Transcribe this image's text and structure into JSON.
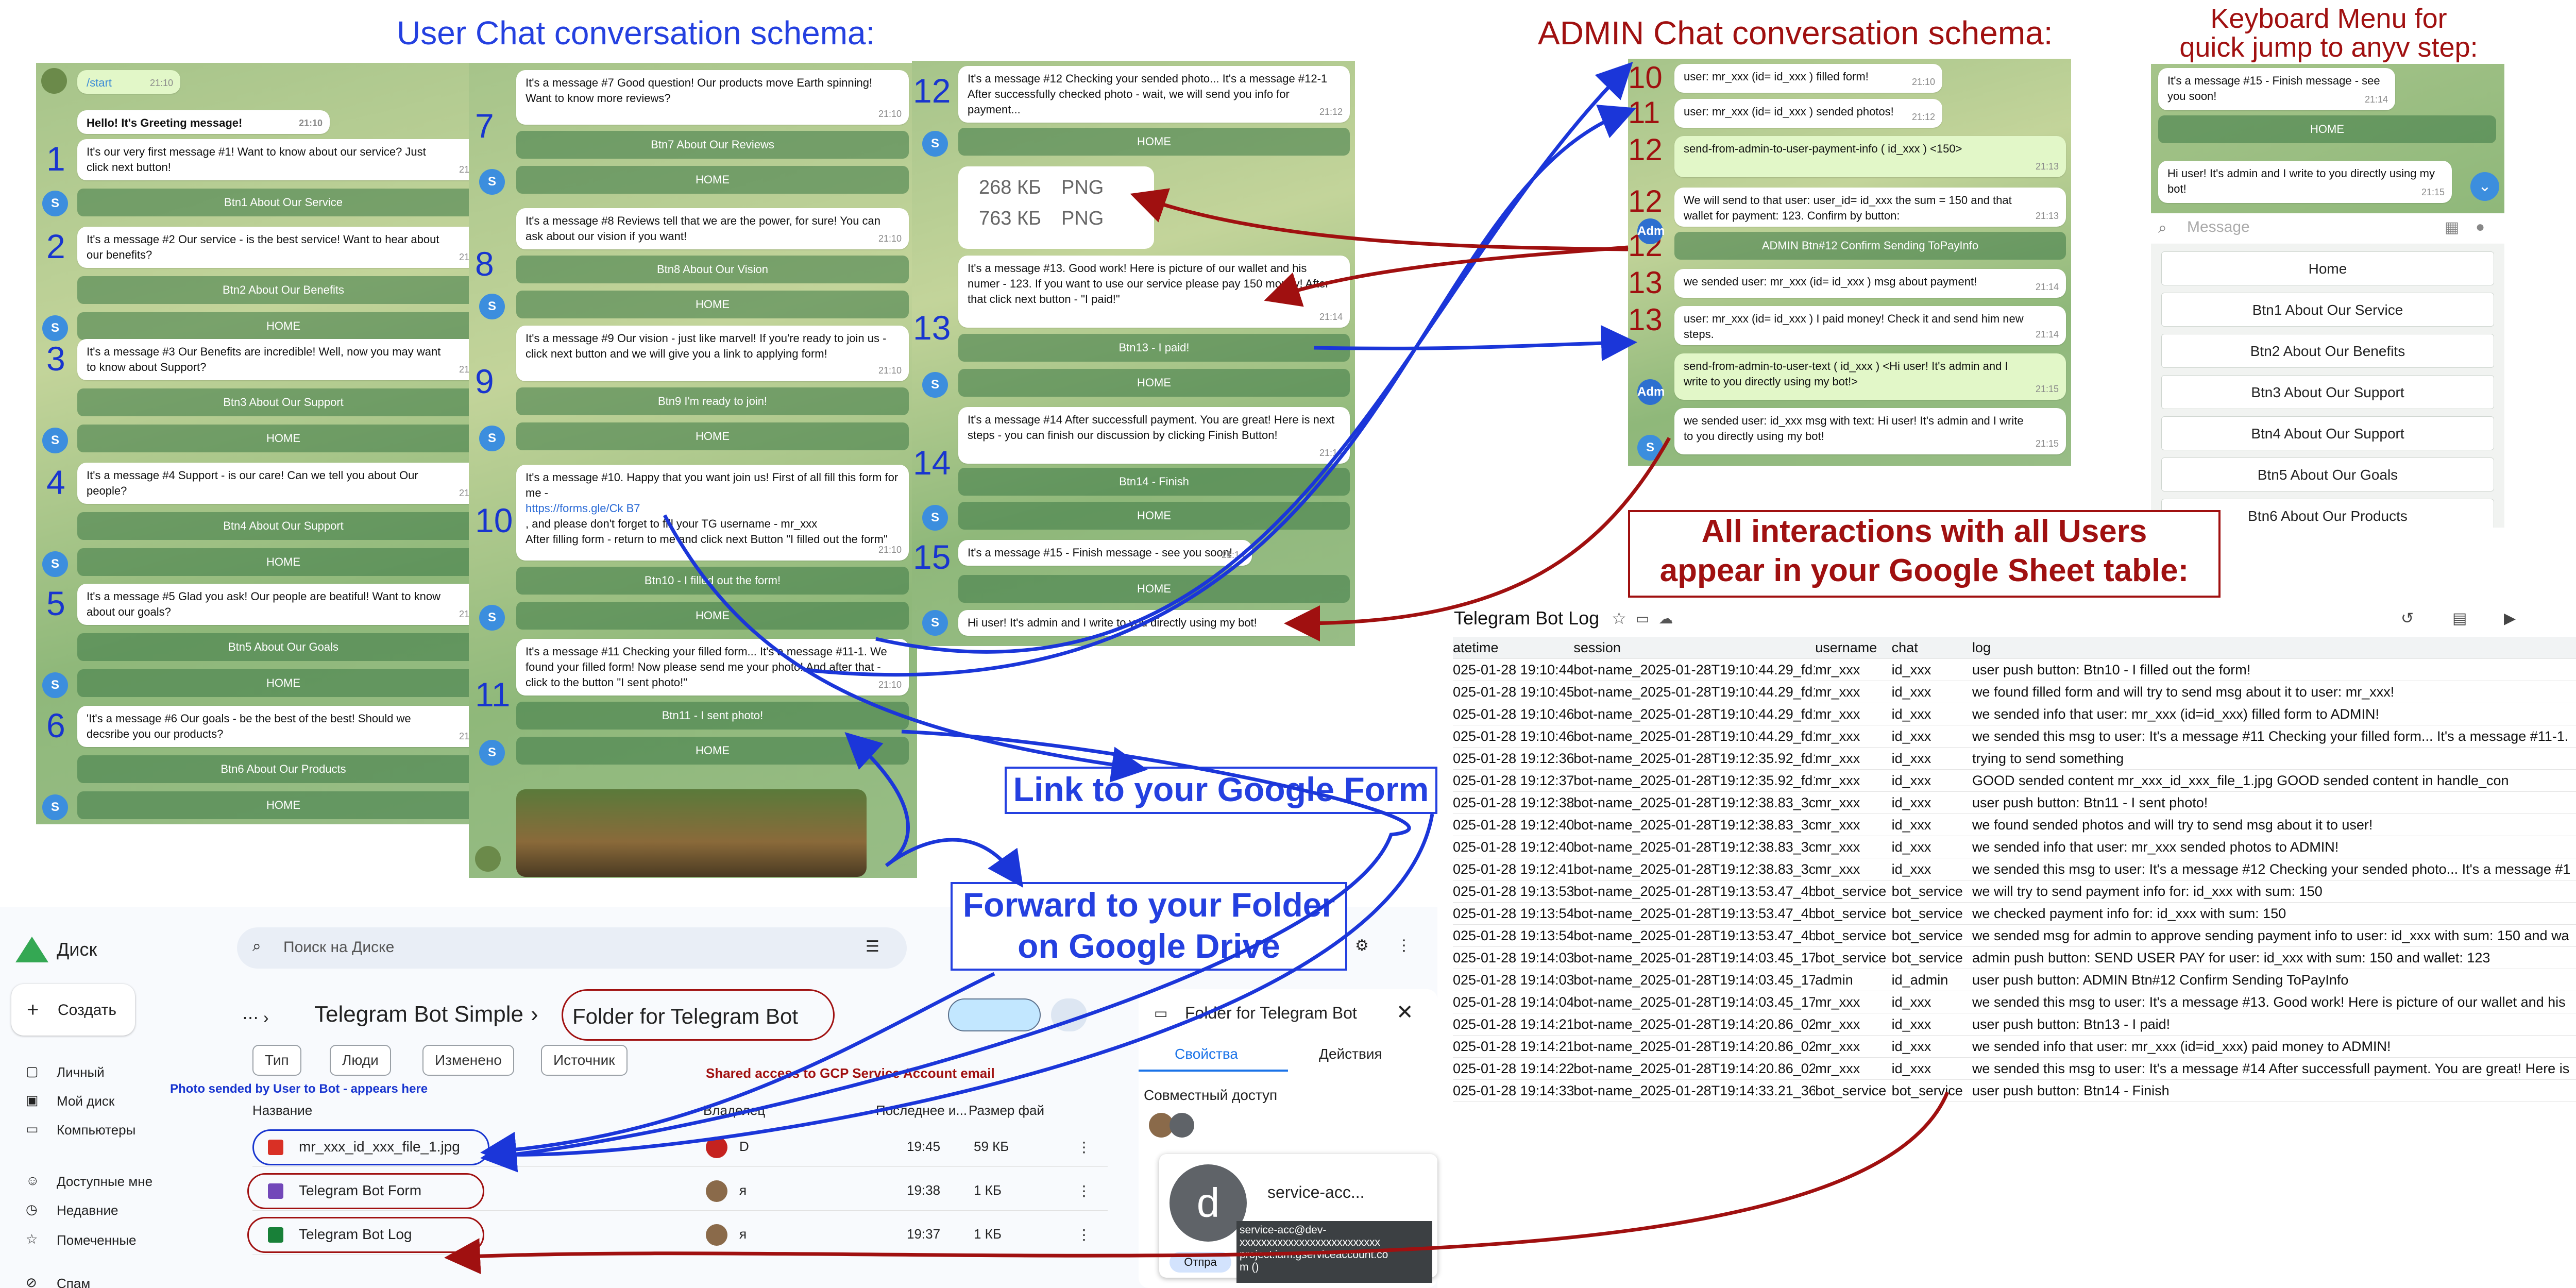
{
  "titles": {
    "user": "User Chat conversation schema:",
    "admin": "ADMIN Chat conversation schema:",
    "keyboard": "Keyboard Menu for\nquick jump to anyv step:",
    "interactions": "All interactions with all Users\nappear in your Google Sheet table:",
    "link_form": "Link to your Google Form",
    "forward_folder": "Forward to your Folder\non Google Drive"
  },
  "colors": {
    "accent_blue": "#2440e0",
    "accent_red": "#a01010",
    "chat_bg": "#a6c48a"
  },
  "col1": {
    "start": {
      "text": "/start",
      "time": "21:10"
    },
    "hello": {
      "text": "Hello! It's Greeting message!",
      "time": "21:10"
    },
    "items": [
      {
        "num": "1",
        "text": "It's our very first message #1! Want to know about our service? Just click next button!",
        "time": "21:10",
        "btn": "Btn1 About Our Service",
        "home": ""
      },
      {
        "num": "2",
        "text": "It's a message #2 Our service - is the best service! Want to hear about our benefits?",
        "time": "21:10",
        "btn": "Btn2 About Our Benefits",
        "home": "HOME"
      },
      {
        "num": "3",
        "text": "It's a message #3 Our Benefits are incredible! Well, now you may want to know about Support?",
        "time": "21:10",
        "btn": "Btn3 About Our Support",
        "home": "HOME"
      },
      {
        "num": "4",
        "text": "It's a message #4 Support - is our care! Can we tell you about Our people?",
        "time": "21:10",
        "btn": "Btn4 About Our Support",
        "home": "HOME"
      },
      {
        "num": "5",
        "text": "It's a message #5 Glad you ask! Our people are beatiful! Want to know about our goals?",
        "time": "21:10",
        "btn": "Btn5 About Our Goals",
        "home": "HOME"
      },
      {
        "num": "6",
        "text": "'It's a message #6 Our goals - be the best of the best! Should we decsribe you our products?",
        "time": "21:10",
        "btn": "Btn6 About Our Products",
        "home": "HOME"
      }
    ]
  },
  "col2": {
    "items": [
      {
        "num": "7",
        "text": "It's a message #7 Good question! Our products move Earth spinning! Want to know more reviews?",
        "time": "21:10",
        "btn": "Btn7 About Our Reviews",
        "home": "HOME"
      },
      {
        "num": "8",
        "text": "It's a message #8 Reviews tell that we are the power, for sure! You can ask about our vision if you want!",
        "time": "21:10",
        "btn": "Btn8 About Our Vision",
        "home": "HOME"
      },
      {
        "num": "9",
        "text": "It's a message #9 Our vision - just like marvel! If you're ready to join us - click next button and we will give you a link to applying form!",
        "time": "21:10",
        "btn": "Btn9 I'm ready to join!",
        "home": "HOME"
      },
      {
        "num": "10",
        "text": "It's a message #10. Happy that you want join us! First of all fill this form for me -",
        "link": "https://forms.gle/Ck                B7",
        "text2": ", and please don't forget to fill your TG username - mr_xxx",
        "text3": "After filling form - return to me and click next Button \"I filled out the form\"",
        "time": "21:10",
        "btn": "Btn10 - I filled out the form!",
        "home": "HOME"
      },
      {
        "num": "11",
        "text": "It's a message #11 Checking your filled form... It's a message #11-1. We found your filled form! Now please send me your photo! And after that - click to the button \"I sent photo!\"",
        "time": "21:10",
        "btn": "Btn11 - I sent photo!",
        "home": "HOME"
      }
    ]
  },
  "col3": {
    "m12": {
      "num": "12",
      "text": "It's a message #12 Checking your sended photo... It's a message #12-1 After successfully checked photo - wait, we will send you info for payment...",
      "time": "21:12",
      "home": "HOME"
    },
    "files": [
      {
        "size": "268 КБ",
        "type": "PNG"
      },
      {
        "size": "763 КБ",
        "type": "PNG"
      }
    ],
    "m13": {
      "num": "13",
      "text": "It's a message #13. Good work! Here is picture of our wallet and his numer - 123. If you want to use our service please pay 150 money! After that click next button - \"I paid!\"",
      "time": "21:14",
      "btn": "Btn13 - I paid!",
      "home": "HOME"
    },
    "m14": {
      "num": "14",
      "text": "It's a message #14 After successfull payment. You are great! Here is next steps - you can finish our discussion by clicking Finish Button!",
      "time": "21:14",
      "btn": "Btn14 - Finish",
      "home": "HOME"
    },
    "m15": {
      "num": "15",
      "text": "It's a message #15 - Finish message - see you soon!",
      "time": "21:14",
      "home": "HOME"
    },
    "admin_msg": "Hi user! It's admin and I write to you directly using my bot!"
  },
  "admin": {
    "rows": [
      {
        "num": "10",
        "text": "user:  mr_xxx (id= id_xxx ) filled form!",
        "time": "21:10"
      },
      {
        "num": "11",
        "text": "user:  mr_xxx (id= id_xxx ) sended photos!",
        "time": "21:12"
      },
      {
        "num": "12",
        "text": "send-from-admin-to-user-payment-info ( id_xxx ) <150>",
        "time": "21:13"
      },
      {
        "num": "12",
        "text": "We will send to that user: user_id= id_xxx  the sum = 150 and that wallet for payment: 123. Confirm by button:",
        "time": "21:13"
      },
      {
        "num": "12",
        "text": "ADMIN Btn#12 Confirm Sending ToPayInfo",
        "time": ""
      },
      {
        "num": "13",
        "text": "we sended user: mr_xxx (id= id_xxx ) msg about payment!",
        "time": "21:14"
      },
      {
        "num": "13",
        "text": "user:  mr_xxx (id= id_xxx ) I paid money! Check it and send him new steps.",
        "time": "21:14"
      },
      {
        "num": "",
        "text": "send-from-admin-to-user-text ( id_xxx ) <Hi user! It's admin and I write to you directly using my bot!>",
        "time": "21:15"
      },
      {
        "num": "",
        "text": "we sended user:  id_xxx    msg with text: Hi user! It's admin and I write to you directly using my bot!",
        "time": "21:15"
      }
    ]
  },
  "keyboard": {
    "top_msg": "It's a message #15 - Finish message - see you soon!",
    "top_time": "21:14",
    "home": "HOME",
    "admin_msg": "Hi user! It's admin and I write to you directly using my bot!",
    "admin_time": "21:15",
    "placeholder": "Message",
    "items": [
      "Home",
      "Btn1 About Our Service",
      "Btn2 About Our Benefits",
      "Btn3 About Our Support",
      "Btn4 About Our Support",
      "Btn5 About Our Goals",
      "Btn6 About Our Products"
    ]
  },
  "sheet": {
    "title": "Telegram Bot Log",
    "headers": [
      "atetime",
      "session",
      "username",
      "chat",
      "log"
    ],
    "rows": [
      [
        "025-01-28 19:10:44",
        "bot-name_2025-01-28T19:10:44.29_fd1",
        "mr_xxx",
        "id_xxx",
        "user push button: Btn10 - I filled out the form!"
      ],
      [
        "025-01-28 19:10:45",
        "bot-name_2025-01-28T19:10:44.29_fd1",
        "mr_xxx",
        "id_xxx",
        "we found filled form and will try to send msg about it to user: mr_xxx!"
      ],
      [
        "025-01-28 19:10:46",
        "bot-name_2025-01-28T19:10:44.29_fd1",
        "mr_xxx",
        "id_xxx",
        "we sended info that user: mr_xxx (id=id_xxx) filled form to ADMIN!"
      ],
      [
        "025-01-28 19:10:46",
        "bot-name_2025-01-28T19:10:44.29_fd1",
        "mr_xxx",
        "id_xxx",
        "we sended this msg to user: It's a message #11 Checking your filled form... It's a message #11-1."
      ],
      [
        "025-01-28 19:12:36",
        "bot-name_2025-01-28T19:12:35.92_fd1",
        "mr_xxx",
        "id_xxx",
        "trying to send something"
      ],
      [
        "025-01-28 19:12:37",
        "bot-name_2025-01-28T19:12:35.92_fd1",
        "mr_xxx",
        "id_xxx",
        "GOOD sended content  mr_xxx_id_xxx_file_1.jpg           GOOD sended content in handle_con"
      ],
      [
        "025-01-28 19:12:38",
        "bot-name_2025-01-28T19:12:38.83_3c",
        "mr_xxx",
        "id_xxx",
        "user push button: Btn11 - I sent photo!"
      ],
      [
        "025-01-28 19:12:40",
        "bot-name_2025-01-28T19:12:38.83_3c",
        "mr_xxx",
        "id_xxx",
        "we found sended photos and will try to send msg about it to user!"
      ],
      [
        "025-01-28 19:12:40",
        "bot-name_2025-01-28T19:12:38.83_3c",
        "mr_xxx",
        "id_xxx",
        "we sended info that user: mr_xxx sended photos to ADMIN!"
      ],
      [
        "025-01-28 19:12:41",
        "bot-name_2025-01-28T19:12:38.83_3c",
        "mr_xxx",
        "id_xxx",
        "we sended this msg to user: It's a message #12 Checking your sended photo... It's a message #1"
      ],
      [
        "025-01-28 19:13:53",
        "bot-name_2025-01-28T19:13:53.47_4b",
        "bot_service",
        "bot_service",
        "we will try to send payment info for: id_xxx with sum: 150"
      ],
      [
        "025-01-28 19:13:54",
        "bot-name_2025-01-28T19:13:53.47_4b",
        "bot_service",
        "bot_service",
        "we checked payment info for: id_xxx with sum: 150"
      ],
      [
        "025-01-28 19:13:54",
        "bot-name_2025-01-28T19:13:53.47_4b",
        "bot_service",
        "bot_service",
        "we sended msg for admin to approve sending payment info to user: id_xxx with sum: 150 and wa"
      ],
      [
        "025-01-28 19:14:03",
        "bot-name_2025-01-28T19:14:03.45_17l",
        "bot_service",
        "bot_service",
        "admin push button: SEND USER PAY for user: id_xxx with sum: 150 and wallet: 123"
      ],
      [
        "025-01-28 19:14:03",
        "bot-name_2025-01-28T19:14:03.45_17l",
        "admin",
        "id_admin",
        "user push button: ADMIN Btn#12 Confirm Sending ToPayInfo"
      ],
      [
        "025-01-28 19:14:04",
        "bot-name_2025-01-28T19:14:03.45_17l",
        "mr_xxx",
        "id_xxx",
        "we sended this msg to user: It's a message #13. Good work! Here is picture of our wallet and his"
      ],
      [
        "025-01-28 19:14:21",
        "bot-name_2025-01-28T19:14:20.86_02",
        "mr_xxx",
        "id_xxx",
        "user push button: Btn13 - I paid!"
      ],
      [
        "025-01-28 19:14:21",
        "bot-name_2025-01-28T19:14:20.86_02",
        "mr_xxx",
        "id_xxx",
        "we sended info that user: mr_xxx (id=id_xxx) paid money to ADMIN!"
      ],
      [
        "025-01-28 19:14:22",
        "bot-name_2025-01-28T19:14:20.86_02",
        "mr_xxx",
        "id_xxx",
        "we sended this msg to user: It's a message #14 After successfull payment. You are great!  Here is"
      ],
      [
        "025-01-28 19:14:33",
        "bot-name_2025-01-28T19:14:33.21_36l",
        "bot_service",
        "bot_service",
        "user push button: Btn14 - Finish"
      ]
    ]
  },
  "drive": {
    "logo": "Диск",
    "search_placeholder": "Поиск на Диске",
    "create": "Создать",
    "nav": [
      "Личный",
      "Мой диск",
      "Компьютеры",
      "Доступные мне",
      "Недавние",
      "Помеченные",
      "Спам"
    ],
    "breadcrumb": [
      "Telegram Bot Simple",
      "Folder for Telegram Bot"
    ],
    "filters": [
      "Тип",
      "Люди",
      "Изменено",
      "Источник"
    ],
    "cols": [
      "Название",
      "Владелец",
      "Последнее и...",
      "Размер фай"
    ],
    "files": [
      {
        "name": "mr_xxx_id_xxx_file_1.jpg",
        "owner": "D",
        "date": "19:45",
        "size": "59 КБ",
        "icon": "image-icon",
        "color": "#d93025"
      },
      {
        "name": "Telegram Bot Form",
        "owner": "я",
        "date": "19:38",
        "size": "1 КБ",
        "icon": "form-icon",
        "color": "#7248b9"
      },
      {
        "name": "Telegram Bot Log",
        "owner": "я",
        "date": "19:37",
        "size": "1 КБ",
        "icon": "sheet-icon",
        "color": "#188038"
      }
    ],
    "detail": {
      "title": "Folder for Telegram Bot",
      "tabs": [
        "Свойства",
        "Действия"
      ],
      "access": "Совместный доступ",
      "avatar": "d",
      "service": "service-acc...",
      "tooltip": "service-acc@dev-\nxxxxxxxxxxxxxxxxxxxxxxxxxx\nproject.iam.gserviceaccount.co\nm ()",
      "send": "Отпра"
    },
    "annot_photo": "Photo sended by User to Bot - appears here",
    "annot_shared": "Shared access to GCP Service Account email"
  }
}
